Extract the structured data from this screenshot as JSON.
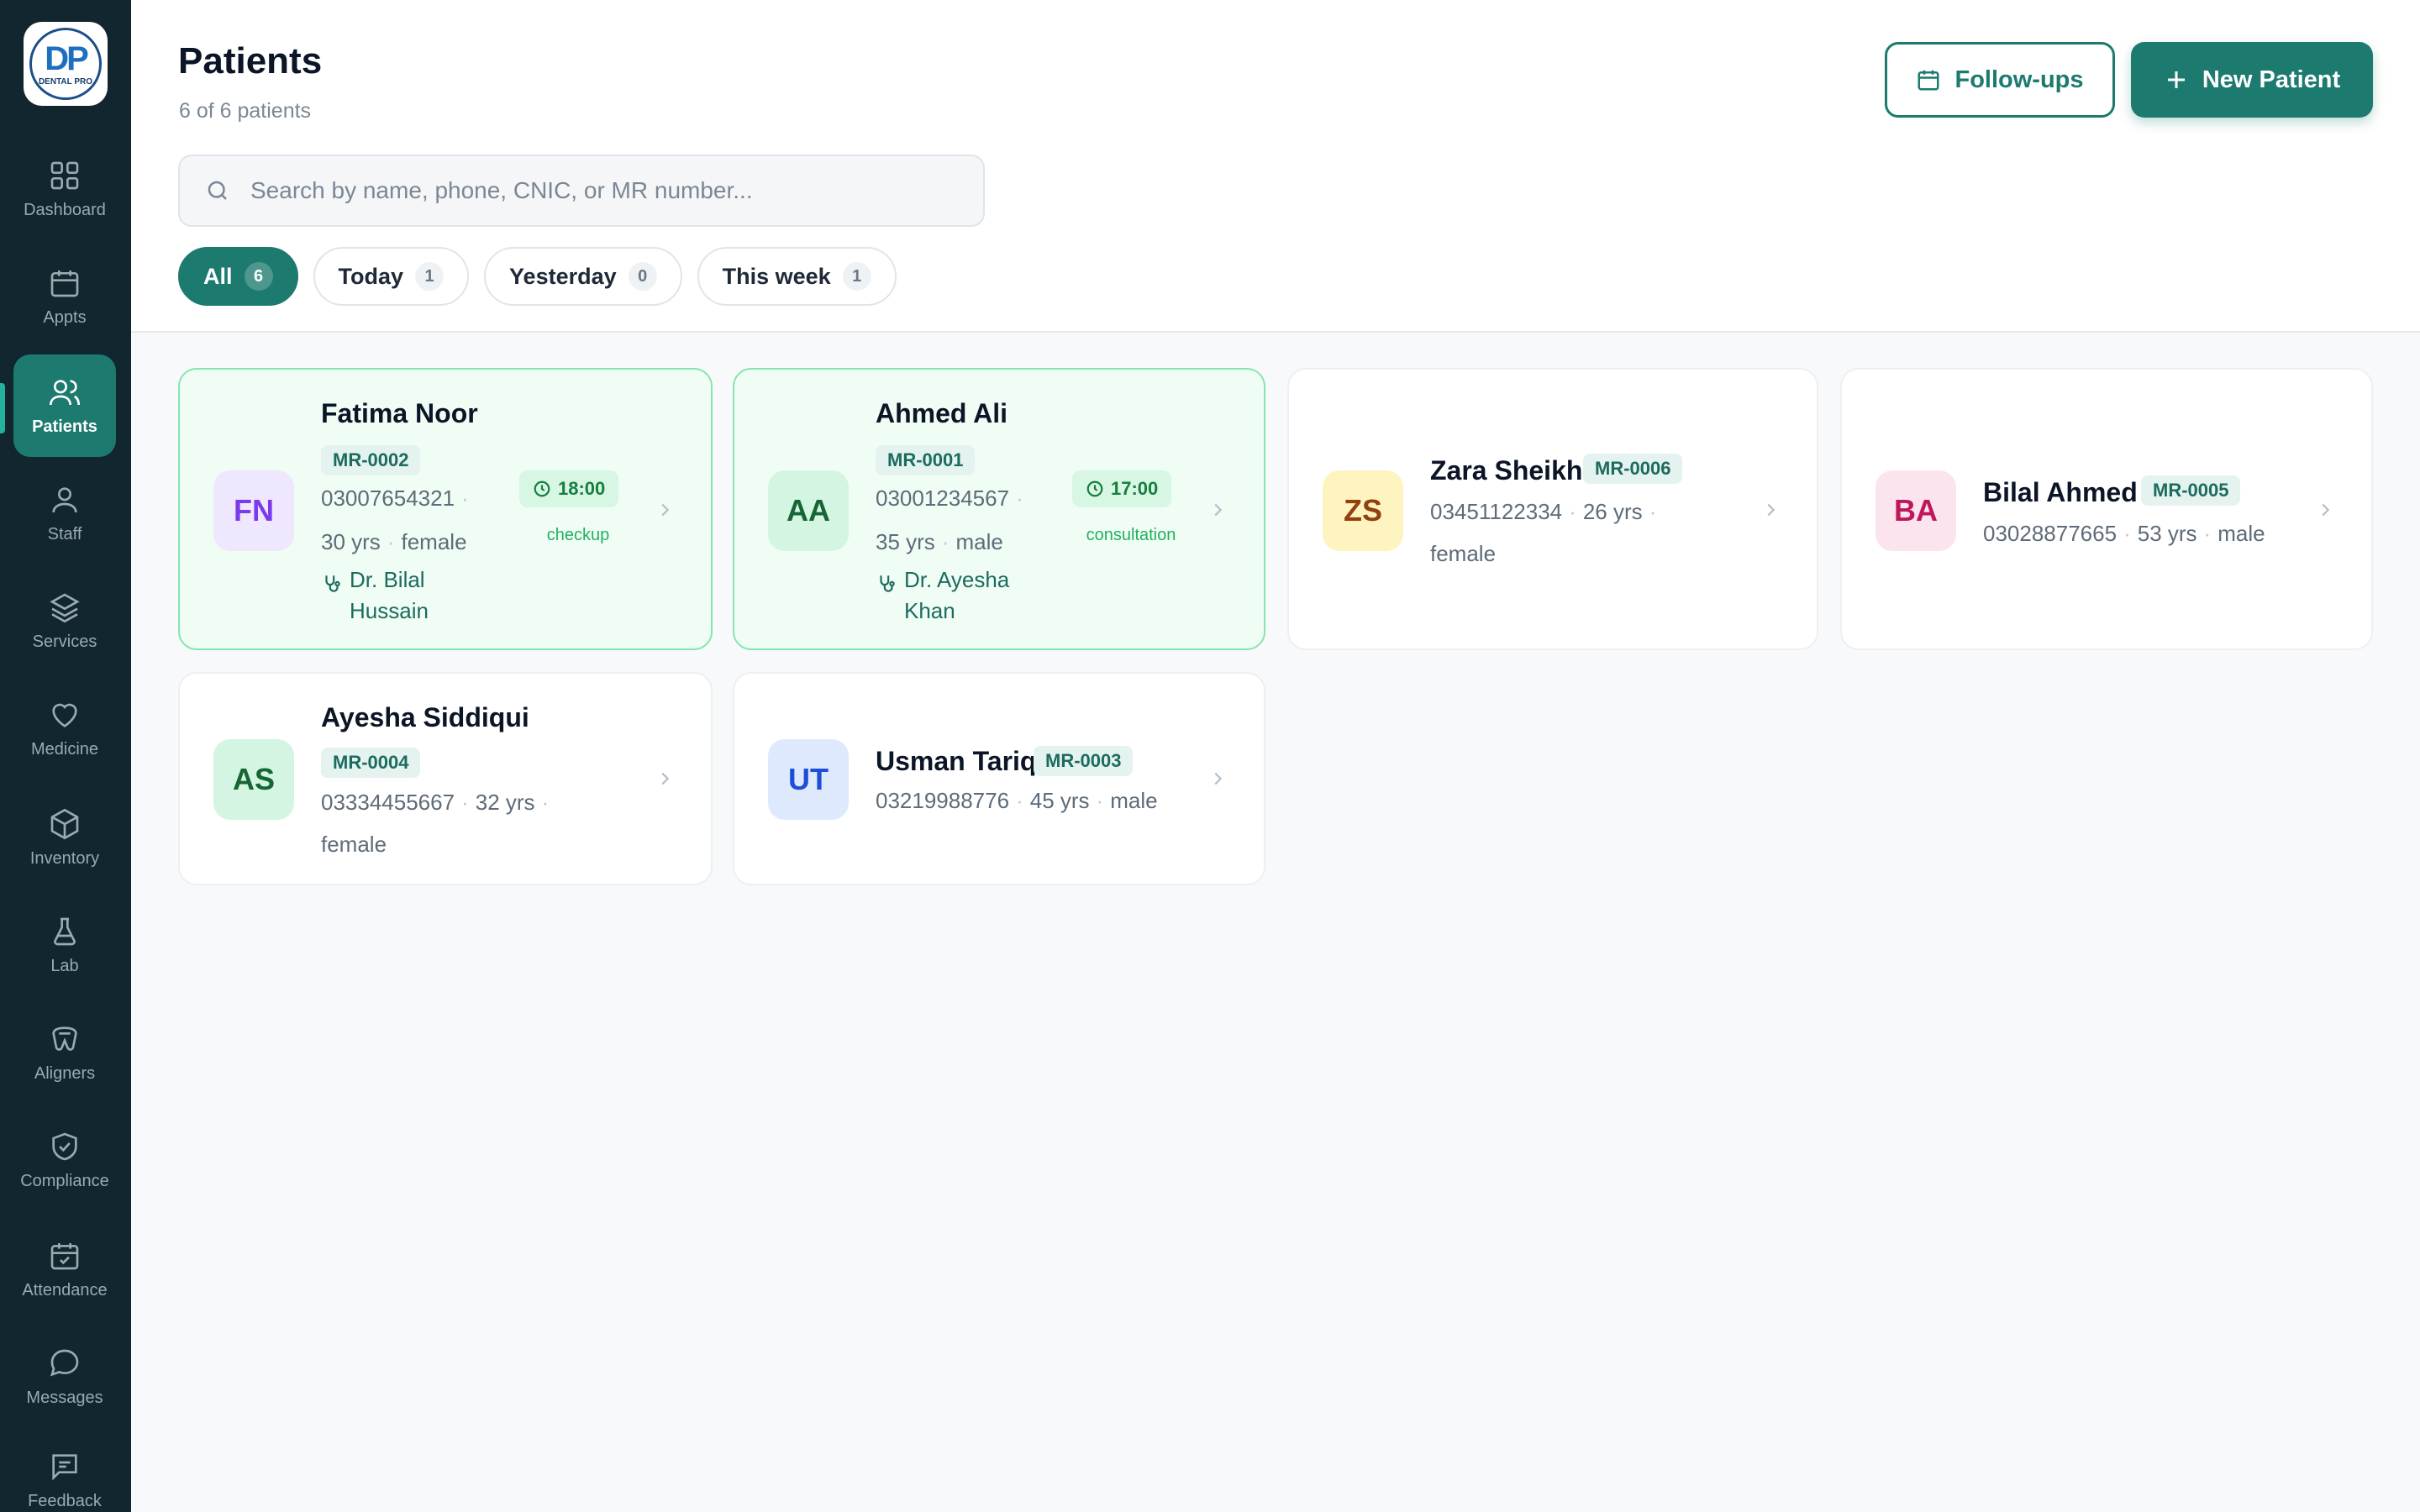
{
  "app": {
    "logo_text": "DENTAL PRO"
  },
  "sidebar": {
    "items": [
      {
        "label": "Dashboard",
        "icon": "grid-icon"
      },
      {
        "label": "Appts",
        "icon": "calendar-icon"
      },
      {
        "label": "Patients",
        "icon": "users-icon",
        "active": true
      },
      {
        "label": "Staff",
        "icon": "user-icon"
      },
      {
        "label": "Services",
        "icon": "layers-icon"
      },
      {
        "label": "Medicine",
        "icon": "heart-icon"
      },
      {
        "label": "Inventory",
        "icon": "box-icon"
      },
      {
        "label": "Lab",
        "icon": "flask-icon"
      },
      {
        "label": "Aligners",
        "icon": "aligner-icon"
      },
      {
        "label": "Compliance",
        "icon": "shield-check-icon"
      },
      {
        "label": "Attendance",
        "icon": "calendar-check-icon"
      },
      {
        "label": "Messages",
        "icon": "chat-icon"
      },
      {
        "label": "Feedback",
        "icon": "feedback-icon"
      }
    ]
  },
  "header": {
    "title": "Patients",
    "subtitle": "6 of 6 patients",
    "followups_label": "Follow-ups",
    "new_patient_label": "New Patient"
  },
  "search": {
    "placeholder": "Search by name, phone, CNIC, or MR number...",
    "value": ""
  },
  "filters": [
    {
      "label": "All",
      "count": "6",
      "active": true
    },
    {
      "label": "Today",
      "count": "1"
    },
    {
      "label": "Yesterday",
      "count": "0"
    },
    {
      "label": "This week",
      "count": "1"
    }
  ],
  "patients": [
    {
      "initials": "FN",
      "name": "Fatima Noor",
      "mr": "MR-0002",
      "phone": "03007654321",
      "age": "30 yrs",
      "gender": "female",
      "time": "18:00",
      "type": "checkup",
      "doctor_line1": "Dr. Bilal",
      "doctor_line2": "Hussain"
    },
    {
      "initials": "AA",
      "name": "Ahmed Ali",
      "mr": "MR-0001",
      "phone": "03001234567",
      "age": "35 yrs",
      "gender": "male",
      "time": "17:00",
      "type": "consultation",
      "doctor_line1": "Dr. Ayesha",
      "doctor_line2": "Khan"
    },
    {
      "initials": "ZS",
      "name": "Zara Sheikh",
      "mr": "MR-0006",
      "phone": "03451122334",
      "age": "26 yrs",
      "gender": "female"
    },
    {
      "initials": "BA",
      "name": "Bilal Ahmed",
      "mr": "MR-0005",
      "phone": "03028877665",
      "age": "53 yrs",
      "gender": "male"
    },
    {
      "initials": "AS",
      "name": "Ayesha Siddiqui",
      "mr": "MR-0004",
      "phone": "03334455667",
      "age": "32 yrs",
      "gender": "female"
    },
    {
      "initials": "UT",
      "name": "Usman Tariq",
      "mr": "MR-0003",
      "phone": "03219988776",
      "age": "45 yrs",
      "gender": "male"
    }
  ],
  "colors": {
    "sidebar_bg": "#11262e",
    "accent": "#1c7a6f",
    "today_card_bg": "#effdf5",
    "today_card_border": "#86e5ae"
  }
}
